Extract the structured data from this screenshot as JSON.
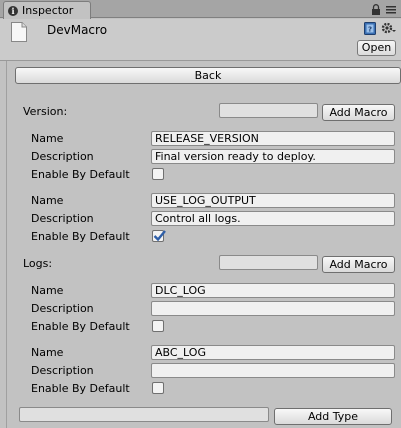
{
  "window": {
    "tab_label": "Inspector"
  },
  "header": {
    "asset_name": "DevMacro",
    "open_label": "Open"
  },
  "main": {
    "back_label": "Back",
    "version_section": {
      "label": "Version:",
      "add_input_value": "",
      "add_button_label": "Add Macro",
      "macros": [
        {
          "name_label": "Name",
          "name": "RELEASE_VERSION",
          "description_label": "Description",
          "description": "Final version ready to deploy.",
          "enable_label": "Enable By Default",
          "enabled": false
        },
        {
          "name_label": "Name",
          "name": "USE_LOG_OUTPUT",
          "description_label": "Description",
          "description": "Control all logs.",
          "enable_label": "Enable By Default",
          "enabled": true
        }
      ]
    },
    "logs_section": {
      "label": "Logs:",
      "add_input_value": "",
      "add_button_label": "Add Macro",
      "macros": [
        {
          "name_label": "Name",
          "name": "DLC_LOG",
          "description_label": "Description",
          "description": "",
          "enable_label": "Enable By Default",
          "enabled": false
        },
        {
          "name_label": "Name",
          "name": "ABC_LOG",
          "description_label": "Description",
          "description": "",
          "enable_label": "Enable By Default",
          "enabled": false
        }
      ]
    },
    "add_type": {
      "input_value": "",
      "button_label": "Add Type"
    }
  },
  "colors": {
    "panel_bg": "#c2c2c2",
    "check_blue": "#2f5fa8"
  }
}
